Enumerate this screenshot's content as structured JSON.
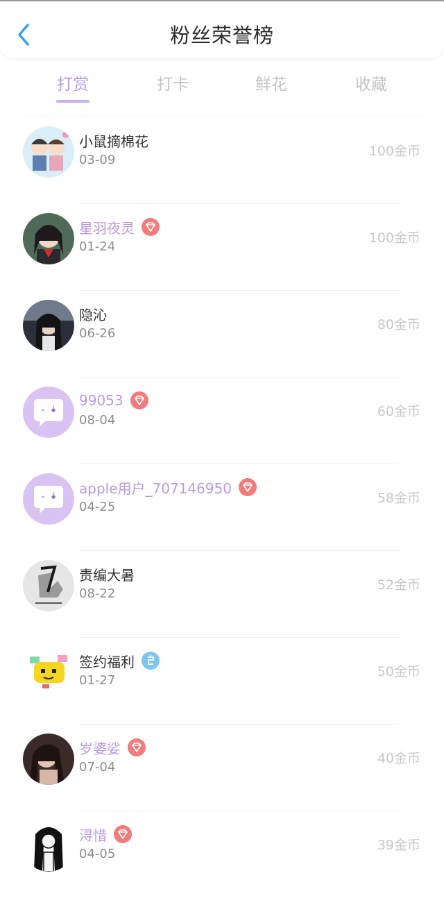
{
  "header": {
    "title": "粉丝荣誉榜"
  },
  "tabs": [
    {
      "label": "打赏",
      "active": true
    },
    {
      "label": "打卡",
      "active": false
    },
    {
      "label": "鲜花",
      "active": false
    },
    {
      "label": "收藏",
      "active": false
    }
  ],
  "colors": {
    "accent": "#b79ae0",
    "diamond_badge": "#f07c7c",
    "official_badge": "#6fc3ef"
  },
  "fans": [
    {
      "name": "小鼠摘棉花",
      "date": "03-09",
      "amount": "100金币",
      "badge": "none"
    },
    {
      "name": "星羽夜灵",
      "date": "01-24",
      "amount": "100金币",
      "badge": "diamond-icon"
    },
    {
      "name": "隐沁",
      "date": "06-26",
      "amount": "80金币",
      "badge": "none"
    },
    {
      "name": "99053",
      "date": "08-04",
      "amount": "60金币",
      "badge": "diamond-icon"
    },
    {
      "name": "apple用户_707146950",
      "date": "04-25",
      "amount": "58金币",
      "badge": "diamond-icon"
    },
    {
      "name": "责编大暑",
      "date": "08-22",
      "amount": "52金币",
      "badge": "none"
    },
    {
      "name": "签约福利",
      "date": "01-27",
      "amount": "50金币",
      "badge": "official-icon"
    },
    {
      "name": "岁婆娑",
      "date": "07-04",
      "amount": "40金币",
      "badge": "diamond-icon"
    },
    {
      "name": "浔惜",
      "date": "04-05",
      "amount": "39金币",
      "badge": "diamond-icon"
    }
  ]
}
